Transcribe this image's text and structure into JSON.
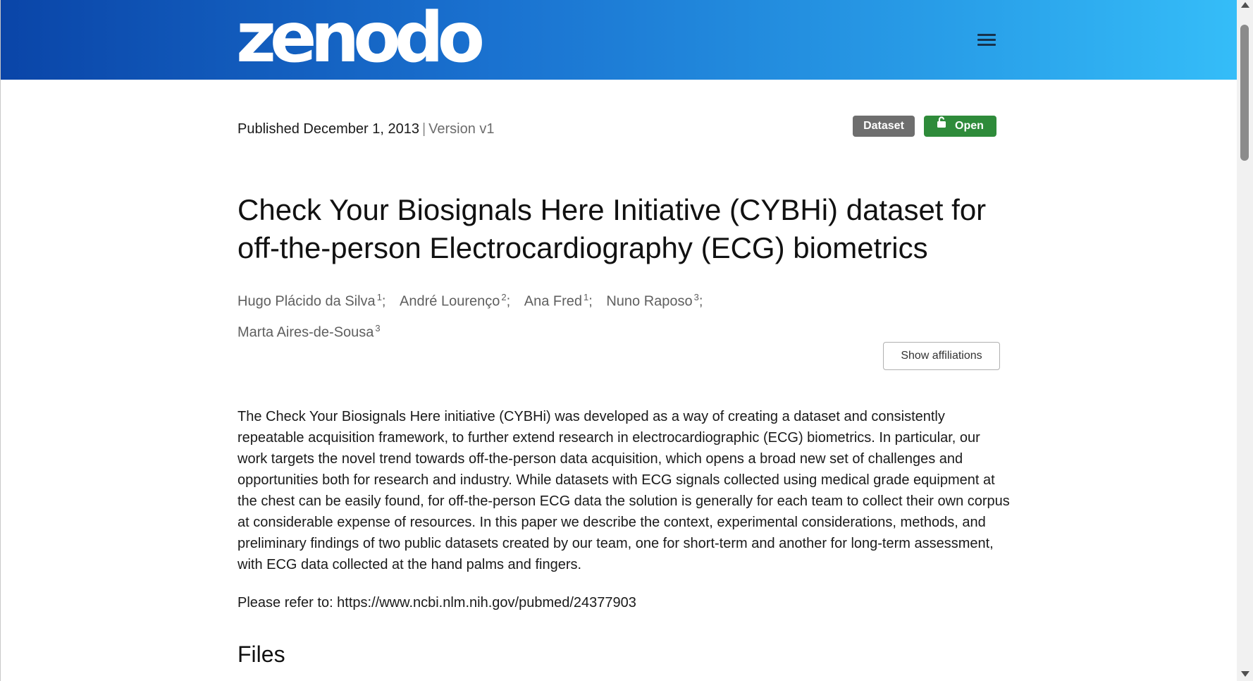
{
  "header": {
    "logo_text": "zenodo",
    "menu_icon": "hamburger-menu-icon",
    "gradient_start": "#0a45a8",
    "gradient_end": "#35bdf8"
  },
  "record": {
    "published_label": "Published December 1, 2013",
    "separator": "|",
    "version": "Version v1",
    "badges": {
      "type": "Dataset",
      "access": "Open",
      "access_icon": "lock-open-icon"
    },
    "title": "Check Your Biosignals Here Initiative (CYBHi) dataset for off-the-person Electrocardiography (ECG) biometrics",
    "authors": [
      {
        "name": "Hugo Plácido da Silva",
        "aff": "1",
        "sep": ";"
      },
      {
        "name": "André Lourenço",
        "aff": "2",
        "sep": ";"
      },
      {
        "name": "Ana Fred",
        "aff": "1",
        "sep": ";"
      },
      {
        "name": "Nuno Raposo",
        "aff": "3",
        "sep": ";"
      },
      {
        "name": "Marta Aires-de-Sousa",
        "aff": "3",
        "sep": ""
      }
    ],
    "show_affiliations": "Show affiliations",
    "description": "The Check Your Biosignals Here initiative (CYBHi) was developed as a way of creating a dataset and consistently repeatable acquisition framework, to further extend research in electrocardiographic (ECG) biometrics. In particular, our work targets the novel trend towards off-the-person data acquisition, which opens a broad new set of challenges and opportunities both for research and industry. While datasets with ECG signals collected using medical grade equipment at the chest can be easily found, for off-the-person ECG data the solution is generally for each team to collect their own corpus at considerable expense of resources. In this paper we describe the context, experimental considerations, methods, and preliminary findings of two public datasets created by our team, one for short-term and another for long-term assessment, with ECG data collected at the hand palms and fingers.",
    "refer": "Please refer to: https://www.ncbi.nlm.nih.gov/pubmed/24377903",
    "files_heading": "Files"
  },
  "colors": {
    "dataset_badge": "#6e6e6e",
    "open_badge": "#2e8b3a"
  }
}
